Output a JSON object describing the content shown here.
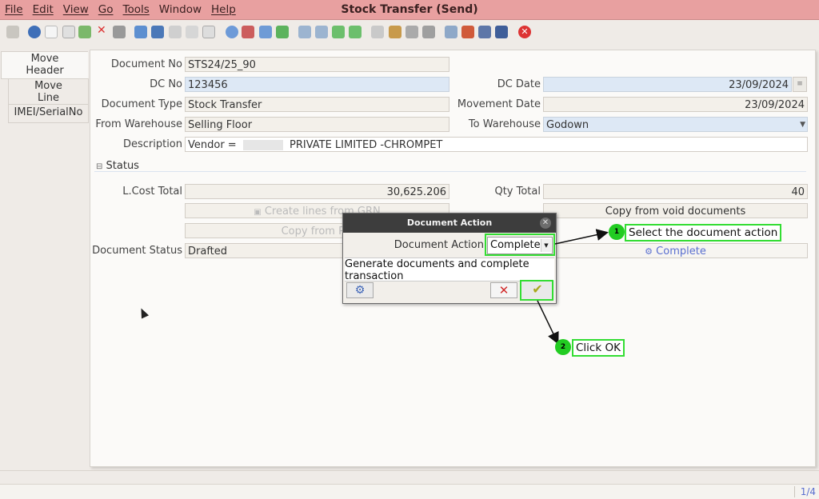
{
  "menu": [
    "File",
    "Edit",
    "View",
    "Go",
    "Tools",
    "Window",
    "Help"
  ],
  "window_title": "Stock Transfer (Send)",
  "tabs": [
    "Move Header",
    "Move Line",
    "IMEI/SerialNo"
  ],
  "form": {
    "document_no_label": "Document No",
    "document_no": "STS24/25_90",
    "dc_no_label": "DC No",
    "dc_no": "123456",
    "dc_date_label": "DC Date",
    "dc_date": "23/09/2024",
    "document_type_label": "Document Type",
    "document_type": "Stock Transfer",
    "movement_date_label": "Movement Date",
    "movement_date": "23/09/2024",
    "from_warehouse_label": "From Warehouse",
    "from_warehouse": "Selling Floor",
    "to_warehouse_label": "To Warehouse",
    "to_warehouse": "Godown",
    "description_label": "Description",
    "description_prefix": "Vendor =",
    "description_suffix": "PRIVATE LIMITED -CHROMPET"
  },
  "status": {
    "section_label": "Status",
    "lcost_label": "L.Cost Total",
    "lcost": "30,625.206",
    "qty_label": "Qty Total",
    "qty": "40",
    "create_lines_btn": "Create lines from GRN",
    "copy_void_btn": "Copy from void documents",
    "copy_from_btn": "Copy from Pic",
    "doc_status_label": "Document Status",
    "doc_status": "Drafted",
    "complete_btn": "Complete"
  },
  "dialog": {
    "title": "Document Action",
    "action_label": "Document Action",
    "action_value": "Complete",
    "description_line1": "Generate documents and complete",
    "description_line2": "transaction"
  },
  "callouts": {
    "step1_num": "1",
    "step1_text": "Select the document action",
    "step2_num": "2",
    "step2_text": "Click OK"
  },
  "pager": "1/4"
}
